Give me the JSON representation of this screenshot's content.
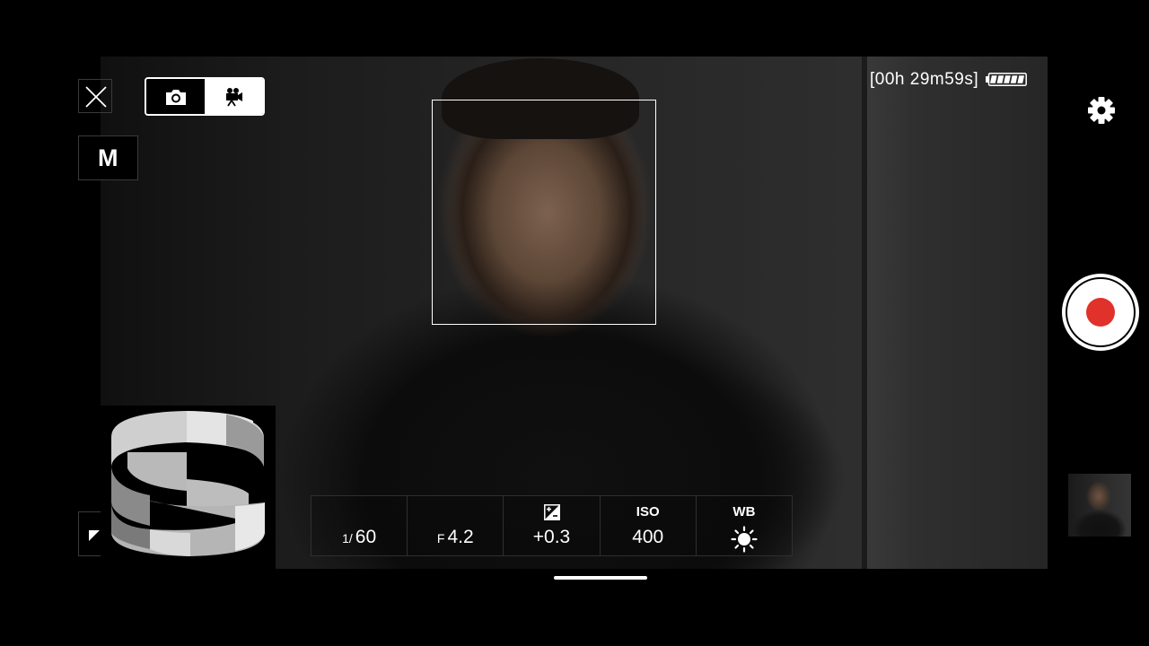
{
  "camera": {
    "mode_buttons": [
      {
        "icon": "camera-icon",
        "selected": false
      },
      {
        "icon": "video-camera-icon",
        "selected": true
      }
    ],
    "exposure_mode": "M",
    "record_time": "[00h 29m59s]",
    "battery_level": 1.0
  },
  "exposure": {
    "shutter_prefix": "1/",
    "shutter_value": "60",
    "aperture_prefix": "F",
    "aperture_value": "4.2",
    "ev_value": "+0.3",
    "iso_title": "ISO",
    "iso_value": "400",
    "wb_title": "WB",
    "wb_icon": "sun-icon"
  },
  "colors": {
    "record": "#e0312a",
    "accent": "#ffffff"
  }
}
